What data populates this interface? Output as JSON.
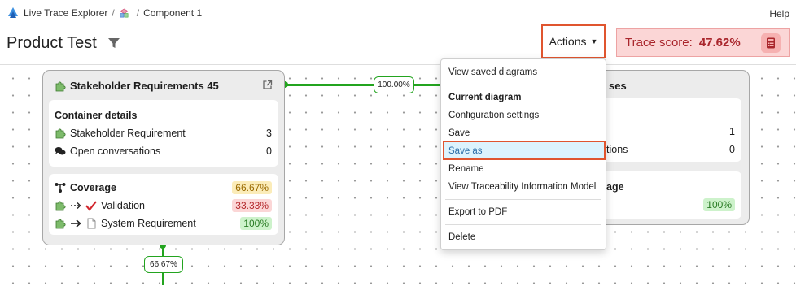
{
  "breadcrumb": {
    "app": "Live Trace Explorer",
    "separator": "/",
    "component": "Component 1"
  },
  "help": "Help",
  "page_title": "Product Test",
  "actions": {
    "label": "Actions"
  },
  "trace_score": {
    "label": "Trace score:",
    "value": "47.62%"
  },
  "card_stakeholder": {
    "title": "Stakeholder Requirements 45",
    "container_heading": "Container details",
    "rows": [
      {
        "label": "Stakeholder Requirement",
        "value": "3"
      },
      {
        "label": "Open conversations",
        "value": "0"
      }
    ],
    "coverage": {
      "heading": "Coverage",
      "heading_value": "66.67%",
      "rows": [
        {
          "label": "Validation",
          "value": "33.33%"
        },
        {
          "label": "System Requirement",
          "value": "100%"
        }
      ]
    }
  },
  "card_right": {
    "title_fragment": "ses",
    "rows": [
      {
        "label": "",
        "value": "1"
      },
      {
        "label": "tions",
        "value": "0"
      }
    ],
    "coverage": {
      "label": "age",
      "value": "100%"
    }
  },
  "connectors": {
    "horizontal": "100.00%",
    "vertical": "66.67%"
  },
  "menu": {
    "items": [
      "View saved diagrams",
      "Current diagram",
      "Configuration settings",
      "Save",
      "Save as",
      "Rename",
      "View Traceability Information Model",
      "Export to PDF",
      "Delete"
    ]
  },
  "colors": {
    "accent_green": "#23a41f",
    "highlight": "#e0552f",
    "trace_bg": "#fbd6d6",
    "trace_text": "#a9262c"
  }
}
